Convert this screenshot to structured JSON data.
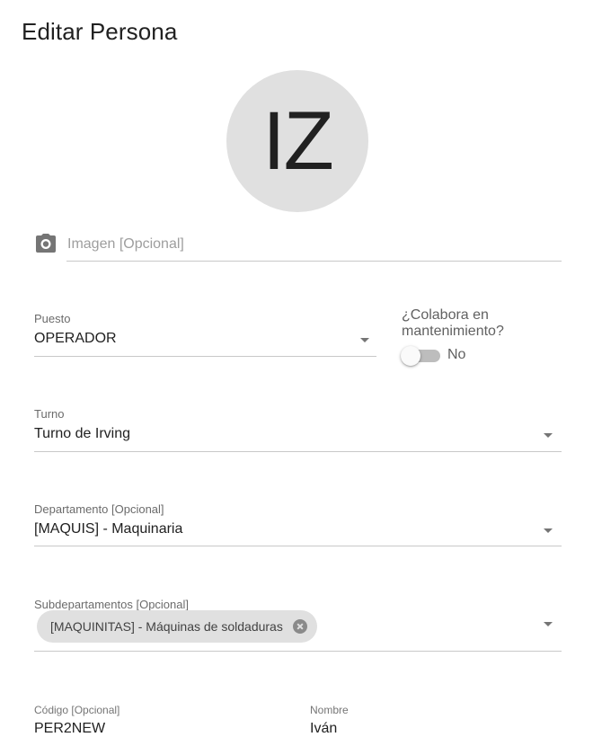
{
  "page": {
    "title": "Editar Persona"
  },
  "avatar": {
    "initials": "IZ"
  },
  "image_field": {
    "icon": "camera-icon",
    "placeholder": "Imagen [Opcional]"
  },
  "puesto": {
    "label": "Puesto",
    "value": "OPERADOR"
  },
  "mantenimiento": {
    "label": "¿Colabora en mantenimiento?",
    "toggle_text": "No",
    "checked": false
  },
  "turno": {
    "label": "Turno",
    "value": "Turno de Irving"
  },
  "departamento": {
    "label": "Departamento [Opcional]",
    "value": "[MAQUIS] - Maquinaria"
  },
  "subdepartamentos": {
    "label": "Subdepartamentos [Opcional]",
    "chips": [
      "[MAQUINITAS] - Máquinas de soldaduras"
    ]
  },
  "codigo": {
    "label": "Código [Opcional]",
    "value": "PER2NEW"
  },
  "nombre": {
    "label": "Nombre",
    "value": "Iván"
  }
}
